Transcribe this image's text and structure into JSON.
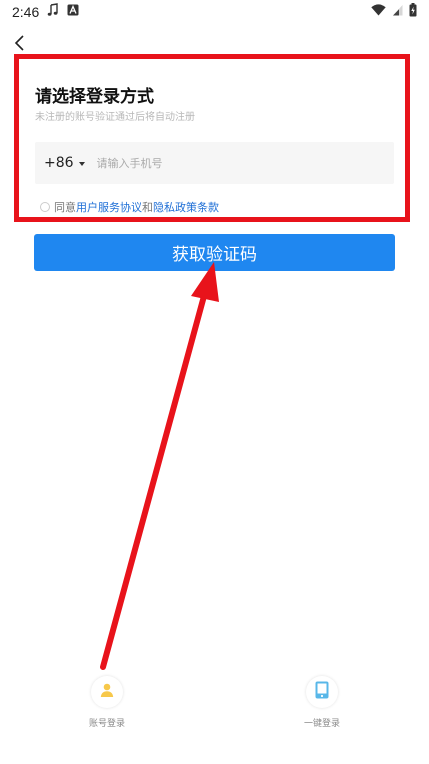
{
  "status_bar": {
    "time": "2:46"
  },
  "login": {
    "title": "请选择登录方式",
    "subtitle": "未注册的账号验证通过后将自动注册",
    "country_code": "+86",
    "phone_placeholder": "请输入手机号",
    "phone_value": "",
    "agreement": {
      "prefix": "同意",
      "user_agreement": "用户服务协议",
      "and": "和",
      "privacy_policy": "隐私政策条款"
    },
    "get_code_label": "获取验证码"
  },
  "bottom_options": {
    "account_login": "账号登录",
    "one_click_login": "一键登录"
  },
  "colors": {
    "primary_button": "#1f87f0",
    "link": "#1f6fd6",
    "annotation": "#e8131b",
    "account_icon": "#f7c84a",
    "phone_icon": "#58b7e8"
  }
}
